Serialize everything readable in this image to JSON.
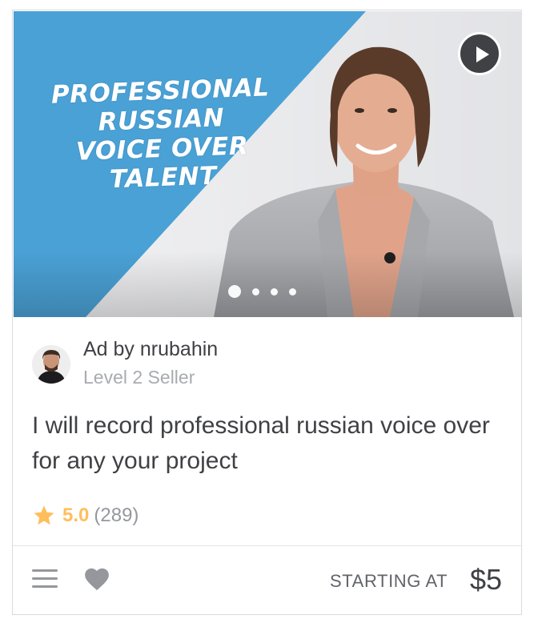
{
  "media": {
    "overlay_lines": [
      "PROFESSIONAL",
      "RUSSIAN",
      "VOICE OVER",
      "TALENT"
    ],
    "play_icon": "play-icon",
    "slides": 4,
    "active_slide": 1,
    "accent_color": "#4aa1d5"
  },
  "seller": {
    "ad_by": "Ad by nrubahin",
    "level": "Level 2 Seller",
    "avatar_icon": "avatar"
  },
  "gig": {
    "title": "I will record professional russian voice over for any your project"
  },
  "rating": {
    "icon": "star-icon",
    "value": "5.0",
    "count": "(289)",
    "star_color": "#ffbe5b"
  },
  "footer": {
    "menu_icon": "menu-icon",
    "heart_icon": "heart-icon",
    "starting_at": "STARTING AT",
    "price": "$5"
  }
}
